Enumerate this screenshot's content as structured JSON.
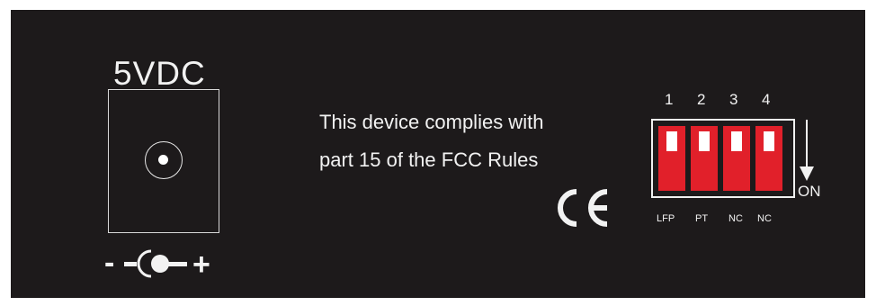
{
  "power": {
    "label": "5VDC",
    "polarity_minus": "-",
    "polarity_plus": "+",
    "polarity_symbol_icon": "center-positive-polarity-icon",
    "jack_icon": "dc-barrel-jack-icon"
  },
  "compliance": {
    "line1": "This device complies with",
    "line2": "part 15 of  the FCC Rules",
    "mark_icon": "ce-mark-icon"
  },
  "dip_switch": {
    "switches": [
      {
        "number": "1",
        "label": "LFP"
      },
      {
        "number": "2",
        "label": "PT"
      },
      {
        "number": "3",
        "label": "NC"
      },
      {
        "number": "4",
        "label": "NC"
      }
    ],
    "on_label": "ON",
    "arrow_icon": "arrow-down-icon",
    "switch_color": "#e1202a"
  },
  "colors": {
    "panel_background": "#1d1a1b",
    "print": "#f2f2f2"
  }
}
